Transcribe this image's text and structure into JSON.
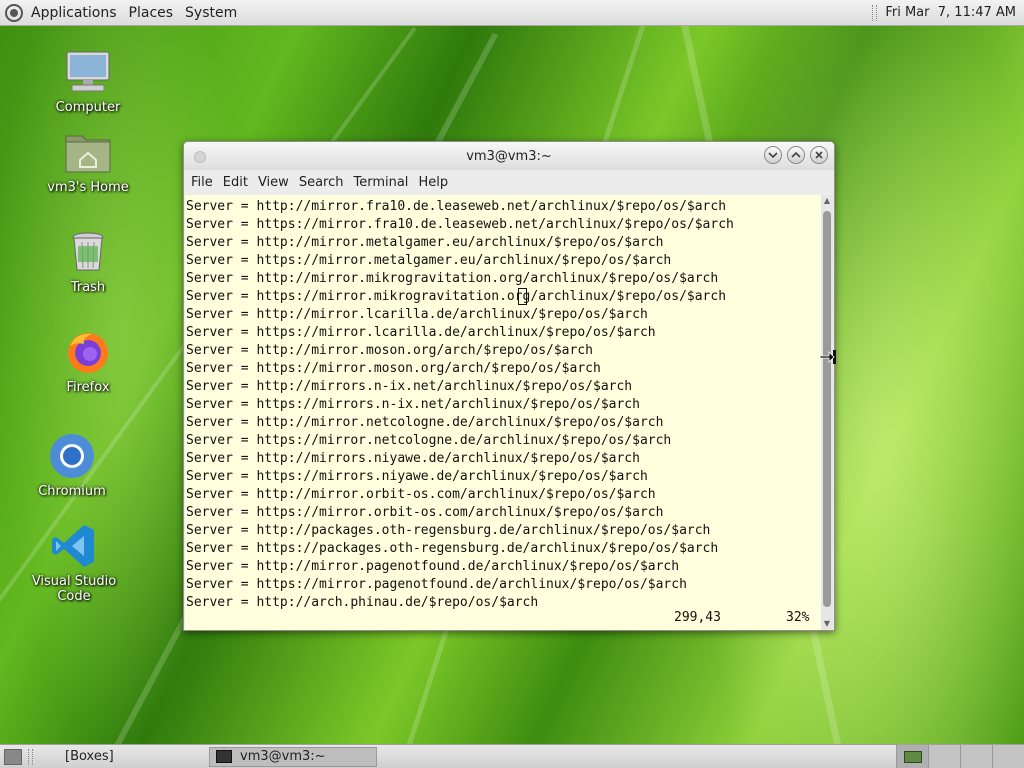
{
  "top_panel": {
    "menus": [
      "Applications",
      "Places",
      "System"
    ],
    "clock": "Fri Mar  7, 11:47 AM"
  },
  "desktop_icons": [
    {
      "label": "Computer",
      "icon": "computer-icon"
    },
    {
      "label": "vm3's Home",
      "icon": "home-folder-icon"
    },
    {
      "label": "Trash",
      "icon": "trash-icon"
    },
    {
      "label": "Firefox",
      "icon": "firefox-icon"
    },
    {
      "label": "Chromium",
      "icon": "chromium-icon"
    },
    {
      "label": "Visual Studio Code",
      "icon": "vscode-icon"
    }
  ],
  "terminal": {
    "title": "vm3@vm3:~",
    "menu": [
      "File",
      "Edit",
      "View",
      "Search",
      "Terminal",
      "Help"
    ],
    "lines": [
      "Server = http://mirror.fra10.de.leaseweb.net/archlinux/$repo/os/$arch",
      "Server = https://mirror.fra10.de.leaseweb.net/archlinux/$repo/os/$arch",
      "Server = http://mirror.metalgamer.eu/archlinux/$repo/os/$arch",
      "Server = https://mirror.metalgamer.eu/archlinux/$repo/os/$arch",
      "Server = http://mirror.mikrogravitation.org/archlinux/$repo/os/$arch",
      "Server = https://mirror.mikrogravitation.org/archlinux/$repo/os/$arch",
      "Server = http://mirror.lcarilla.de/archlinux/$repo/os/$arch",
      "Server = https://mirror.lcarilla.de/archlinux/$repo/os/$arch",
      "Server = http://mirror.moson.org/arch/$repo/os/$arch",
      "Server = https://mirror.moson.org/arch/$repo/os/$arch",
      "Server = http://mirrors.n-ix.net/archlinux/$repo/os/$arch",
      "Server = https://mirrors.n-ix.net/archlinux/$repo/os/$arch",
      "Server = http://mirror.netcologne.de/archlinux/$repo/os/$arch",
      "Server = https://mirror.netcologne.de/archlinux/$repo/os/$arch",
      "Server = http://mirrors.niyawe.de/archlinux/$repo/os/$arch",
      "Server = https://mirrors.niyawe.de/archlinux/$repo/os/$arch",
      "Server = http://mirror.orbit-os.com/archlinux/$repo/os/$arch",
      "Server = https://mirror.orbit-os.com/archlinux/$repo/os/$arch",
      "Server = http://packages.oth-regensburg.de/archlinux/$repo/os/$arch",
      "Server = https://packages.oth-regensburg.de/archlinux/$repo/os/$arch",
      "Server = http://mirror.pagenotfound.de/archlinux/$repo/os/$arch",
      "Server = https://mirror.pagenotfound.de/archlinux/$repo/os/$arch",
      "Server = http://arch.phinau.de/$repo/os/$arch"
    ],
    "status_position": "299,43",
    "status_percent": "32%",
    "background_color": "#ffffdd"
  },
  "bottom_panel": {
    "tasks": [
      {
        "label": "[Boxes]",
        "active": false
      },
      {
        "label": "vm3@vm3:~",
        "active": true
      }
    ],
    "workspace_count": 4,
    "active_workspace": 1
  }
}
